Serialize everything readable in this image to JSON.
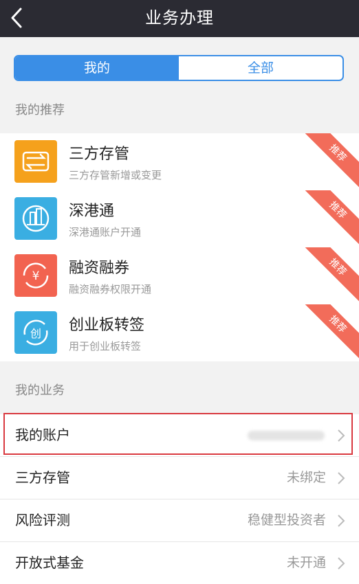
{
  "header": {
    "title": "业务办理",
    "back_icon": "chevron-left-icon"
  },
  "tabs": [
    {
      "label": "我的",
      "active": true
    },
    {
      "label": "全部",
      "active": false
    }
  ],
  "recommend": {
    "section_title": "我的推荐",
    "badge_label": "推荐",
    "items": [
      {
        "title": "三方存管",
        "subtitle": "三方存管新增或变更",
        "icon": "transfer-icon",
        "color": "#f5a11c"
      },
      {
        "title": "深港通",
        "subtitle": "深港通账户开通",
        "icon": "building-icon",
        "color": "#3aaee2"
      },
      {
        "title": "融资融券",
        "subtitle": "融资融券权限开通",
        "icon": "yen-icon",
        "color": "#f26350"
      },
      {
        "title": "创业板转签",
        "subtitle": "用于创业板转签",
        "icon": "chuang-icon",
        "color": "#3aaee2"
      }
    ]
  },
  "business": {
    "section_title": "我的业务",
    "rows": [
      {
        "label": "我的账户",
        "value": ""
      },
      {
        "label": "三方存管",
        "value": "未绑定"
      },
      {
        "label": "风险评测",
        "value": "稳健型投资者"
      },
      {
        "label": "开放式基金",
        "value": "未开通"
      }
    ]
  },
  "colors": {
    "header_bg": "#2b2b33",
    "accent": "#3a8ee6",
    "badge": "#f26c5a",
    "highlight": "#d9383f"
  }
}
